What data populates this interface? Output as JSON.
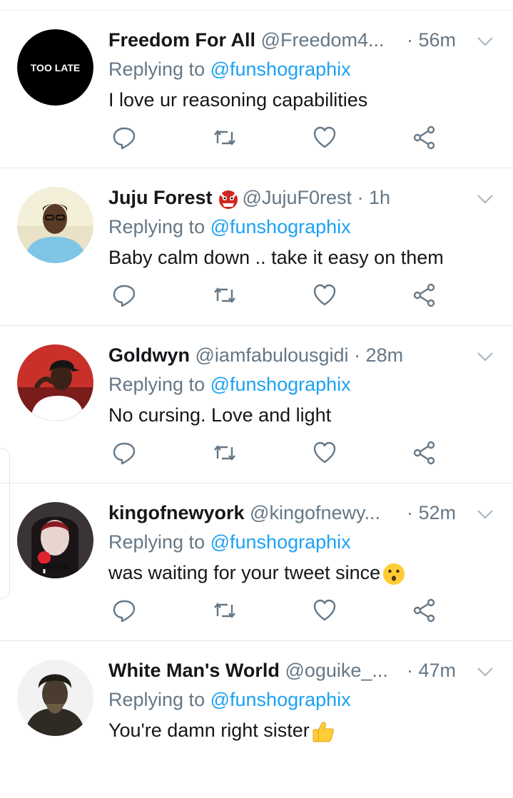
{
  "reply_prefix": "Replying to",
  "colors": {
    "accent": "#1da1f2",
    "muted": "#657786",
    "text": "#14171a",
    "divider": "#e1e8ed"
  },
  "tweets": [
    {
      "name": "Freedom For All",
      "handle": "@Freedom4...",
      "time": "· 56m",
      "replying_to": "@funshographix",
      "text": "I love ur reasoning capabilities",
      "avatar": "too-late-logo",
      "avatar_text": "TOO LATE",
      "badge": null,
      "emoji": null
    },
    {
      "name": "Juju Forest",
      "handle": "@JujuF0rest",
      "time": "· 1h",
      "replying_to": "@funshographix",
      "text": "Baby calm down .. take it easy on them",
      "avatar": "photo-man",
      "badge": "ogre-emoji",
      "emoji": null
    },
    {
      "name": "Goldwyn",
      "handle": "@iamfabulousgidi",
      "time": "· 28m",
      "replying_to": "@funshographix",
      "text": "No cursing. Love and light",
      "avatar": "photo-man-cap",
      "badge": null,
      "emoji": null
    },
    {
      "name": "kingofnewyork",
      "handle": "@kingofnewy...",
      "time": "· 52m",
      "replying_to": "@funshographix",
      "text": "was waiting for your tweet since",
      "avatar": "photo-woman",
      "badge": null,
      "emoji": "kissing-face-emoji"
    },
    {
      "name": "White Man's World",
      "handle": "@oguike_...",
      "time": "· 47m",
      "replying_to": "@funshographix",
      "text": "You're damn right sister",
      "avatar": "photo-statue",
      "badge": null,
      "emoji": "thumbs-up-emoji"
    }
  ],
  "actions": [
    "reply-icon",
    "retweet-icon",
    "like-icon",
    "share-icon"
  ]
}
